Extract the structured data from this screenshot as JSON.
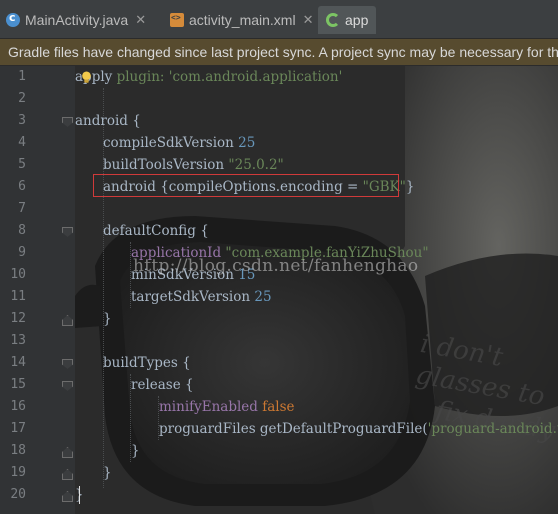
{
  "tabs": [
    {
      "label": "MainActivity.java",
      "icon": "java-class-icon",
      "active": false
    },
    {
      "label": "activity_main.xml",
      "icon": "xml-layout-icon",
      "active": false
    },
    {
      "label": "app",
      "icon": "gradle-icon",
      "active": true
    }
  ],
  "banner": {
    "text": "Gradle files have changed since last project sync. A project sync may be necessary for th"
  },
  "editor": {
    "line_numbers": [
      "1",
      "2",
      "3",
      "4",
      "5",
      "6",
      "7",
      "8",
      "9",
      "10",
      "11",
      "12",
      "13",
      "14",
      "15",
      "16",
      "17",
      "18",
      "19",
      "20"
    ],
    "watermark": "http://blog.csdn.net/fanhenghao",
    "handwriting": [
      "i don't",
      "glasses to",
      "fix dandy"
    ]
  },
  "code": {
    "l1_apply": "apply",
    "l1_plugin": "plugin:",
    "l1_val": "'com.android.application'",
    "l3": "android {",
    "l4_kw": "compileSdkVersion",
    "l4_num": "25",
    "l5_kw": "buildToolsVersion",
    "l5_str": "\"25.0.2\"",
    "l6_kw": "android {compileOptions.encoding =",
    "l6_str": "\"GBK\"",
    "l6_end": "}",
    "l8": "defaultConfig {",
    "l9_kw": "applicationId",
    "l9_str": "\"com.example.fanYiZhuShou\"",
    "l10_kw": "minSdkVersion",
    "l10_num": "15",
    "l11_kw": "targetSdkVersion",
    "l11_num": "25",
    "l12": "}",
    "l14": "buildTypes {",
    "l15": "release {",
    "l16_kw": "minifyEnabled",
    "l16_val": "false",
    "l17_kw": "proguardFiles getDefaultProguardFile(",
    "l17_str": "'proguard-android.tx",
    "l19": "}",
    "l20": "}",
    "l21": "}"
  },
  "colors": {
    "background": "#2b2b2b",
    "keyword": "#cc7832",
    "string": "#6a8759",
    "number": "#6897bb",
    "property": "#9876aa",
    "text": "#a9b7c6",
    "highlight_box": "#d03a3a",
    "banner": "#574b2f"
  }
}
